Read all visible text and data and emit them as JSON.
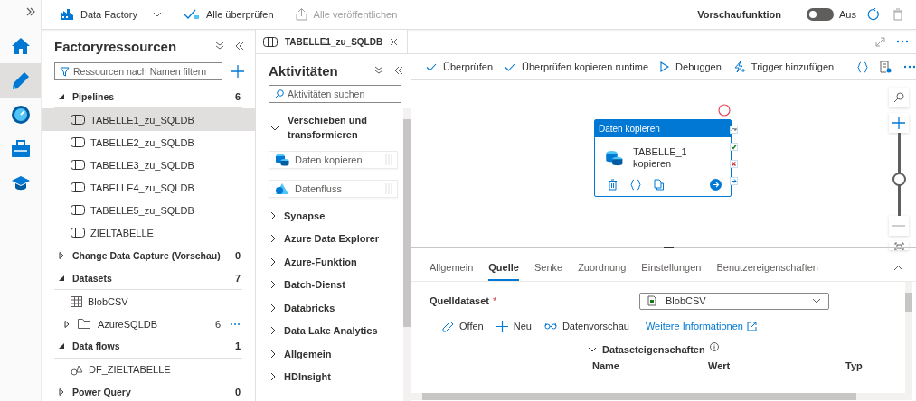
{
  "nav_rail": [
    {
      "kind": "home",
      "selected": false
    },
    {
      "kind": "author",
      "selected": true
    },
    {
      "kind": "monitor",
      "selected": false
    },
    {
      "kind": "manage",
      "selected": false
    },
    {
      "kind": "learn",
      "selected": false
    }
  ],
  "top_bar": {
    "factory_name": "Data Factory",
    "validate_all": "Alle überprüfen",
    "publish_all": {
      "label": "Alle veröffentlichen",
      "disabled": true
    },
    "preview": {
      "label": "Vorschaufunktion",
      "on": false,
      "state_text": "Aus"
    }
  },
  "resources": {
    "title": "Factoryressourcen",
    "filter_placeholder": "Ressourcen nach Namen filtern",
    "groups": [
      {
        "label": "Pipelines",
        "count": "6",
        "expanded": true,
        "children": [
          {
            "label": "TABELLE1_zu_SQLDB",
            "kind": "pipeline",
            "selected": true
          },
          {
            "label": "TABELLE2_zu_SQLDB",
            "kind": "pipeline",
            "selected": false
          },
          {
            "label": "TABELLE3_zu_SQLDB",
            "kind": "pipeline",
            "selected": false
          },
          {
            "label": "TABELLE4_zu_SQLDB",
            "kind": "pipeline",
            "selected": false
          },
          {
            "label": "TABELLE5_zu_SQLDB",
            "kind": "pipeline",
            "selected": false
          },
          {
            "label": "ZIELTABELLE",
            "kind": "pipeline",
            "selected": false
          }
        ]
      },
      {
        "label": "Change Data Capture (Vorschau)",
        "count": "0",
        "expanded": false
      },
      {
        "label": "Datasets",
        "count": "7",
        "expanded": true,
        "children": [
          {
            "label": "BlobCSV",
            "kind": "dataset",
            "selected": false
          },
          {
            "label": "AzureSQLDB",
            "kind": "folder",
            "selected": false,
            "expanded": false,
            "count": "6"
          }
        ]
      },
      {
        "label": "Data flows",
        "count": "1",
        "expanded": true,
        "children": [
          {
            "label": "DF_ZIELTABELLE",
            "kind": "dataflow",
            "selected": false
          }
        ]
      },
      {
        "label": "Power Query",
        "count": "0",
        "expanded": false
      }
    ]
  },
  "open_tabs": [
    {
      "label": "TABELLE1_zu_SQLDB",
      "selected": true
    }
  ],
  "activities": {
    "title": "Aktivitäten",
    "search_placeholder": "Aktivitäten suchen",
    "categories": [
      {
        "label": "Verschieben und transformieren",
        "expanded": true,
        "items": [
          {
            "label": "Daten kopieren",
            "kind": "copy"
          },
          {
            "label": "Datenfluss",
            "kind": "dataflow"
          }
        ]
      },
      {
        "label": "Synapse",
        "expanded": false
      },
      {
        "label": "Azure Data Explorer",
        "expanded": false
      },
      {
        "label": "Azure-Funktion",
        "expanded": false
      },
      {
        "label": "Batch-Dienst",
        "expanded": false
      },
      {
        "label": "Databricks",
        "expanded": false
      },
      {
        "label": "Data Lake Analytics",
        "expanded": false
      },
      {
        "label": "Allgemein",
        "expanded": false
      },
      {
        "label": "HDInsight",
        "expanded": false
      }
    ]
  },
  "pipeline_toolbar": [
    {
      "label": "Überprüfen",
      "kind": "check"
    },
    {
      "label": "Überprüfen kopieren runtime",
      "kind": "check"
    },
    {
      "label": "Debuggen",
      "kind": "play"
    },
    {
      "label": "Trigger hinzufügen",
      "kind": "trigger"
    }
  ],
  "canvas": {
    "activity": {
      "header": "Daten kopieren",
      "name": "TABELLE_1 kopieren"
    },
    "zoom": {
      "level": 0.45
    }
  },
  "properties": {
    "tabs": [
      {
        "label": "Allgemein",
        "selected": false
      },
      {
        "label": "Quelle",
        "selected": true
      },
      {
        "label": "Senke",
        "selected": false
      },
      {
        "label": "Zuordnung",
        "selected": false
      },
      {
        "label": "Einstellungen",
        "selected": false
      },
      {
        "label": "Benutzereigenschaften",
        "selected": false
      }
    ],
    "source_dataset": {
      "label": "Quelldataset",
      "required": true,
      "required_mark": "*",
      "value": "BlobCSV"
    },
    "actions": [
      {
        "label": "Offen",
        "kind": "edit"
      },
      {
        "label": "Neu",
        "kind": "add"
      },
      {
        "label": "Datenvorschau",
        "kind": "preview"
      }
    ],
    "link": "Weitere Informationen",
    "section": {
      "label": "Dataseteigenschaften",
      "expanded": true
    },
    "columns": [
      "Name",
      "Wert",
      "Typ"
    ]
  }
}
